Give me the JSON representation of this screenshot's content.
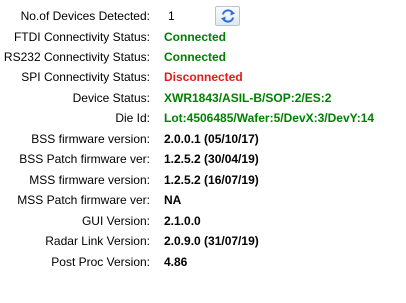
{
  "devices": {
    "label": "No.of Devices Detected:",
    "count": "1",
    "refresh_icon": "refresh-icon"
  },
  "fields": [
    {
      "label": "FTDI Connectivity Status:",
      "value": "Connected",
      "status": "ok"
    },
    {
      "label": "RS232 Connectivity Status:",
      "value": "Connected",
      "status": "ok"
    },
    {
      "label": "SPI Connectivity Status:",
      "value": "Disconnected",
      "status": "bad"
    },
    {
      "label": "Device Status:",
      "value": "XWR1843/ASIL-B/SOP:2/ES:2",
      "status": "ok"
    },
    {
      "label": "Die Id:",
      "value": "Lot:4506485/Wafer:5/DevX:3/DevY:14",
      "status": "ok"
    },
    {
      "label": "BSS firmware version:",
      "value": "2.0.0.1 (05/10/17)",
      "status": "plain"
    },
    {
      "label": "BSS Patch firmware ver:",
      "value": "1.2.5.2 (30/04/19)",
      "status": "plain"
    },
    {
      "label": "MSS firmware version:",
      "value": "1.2.5.2 (16/07/19)",
      "status": "plain"
    },
    {
      "label": "MSS Patch firmware ver:",
      "value": "NA",
      "status": "plain"
    },
    {
      "label": "GUI Version:",
      "value": "2.1.0.0",
      "status": "plain"
    },
    {
      "label": "Radar Link Version:",
      "value": "2.0.9.0 (31/07/19)",
      "status": "plain"
    },
    {
      "label": "Post Proc Version:",
      "value": "4.86",
      "status": "plain"
    }
  ],
  "colors": {
    "ok": "#008000",
    "bad": "#e31b1b",
    "plain": "#000000",
    "refresh_icon": "#2e6fd8"
  }
}
